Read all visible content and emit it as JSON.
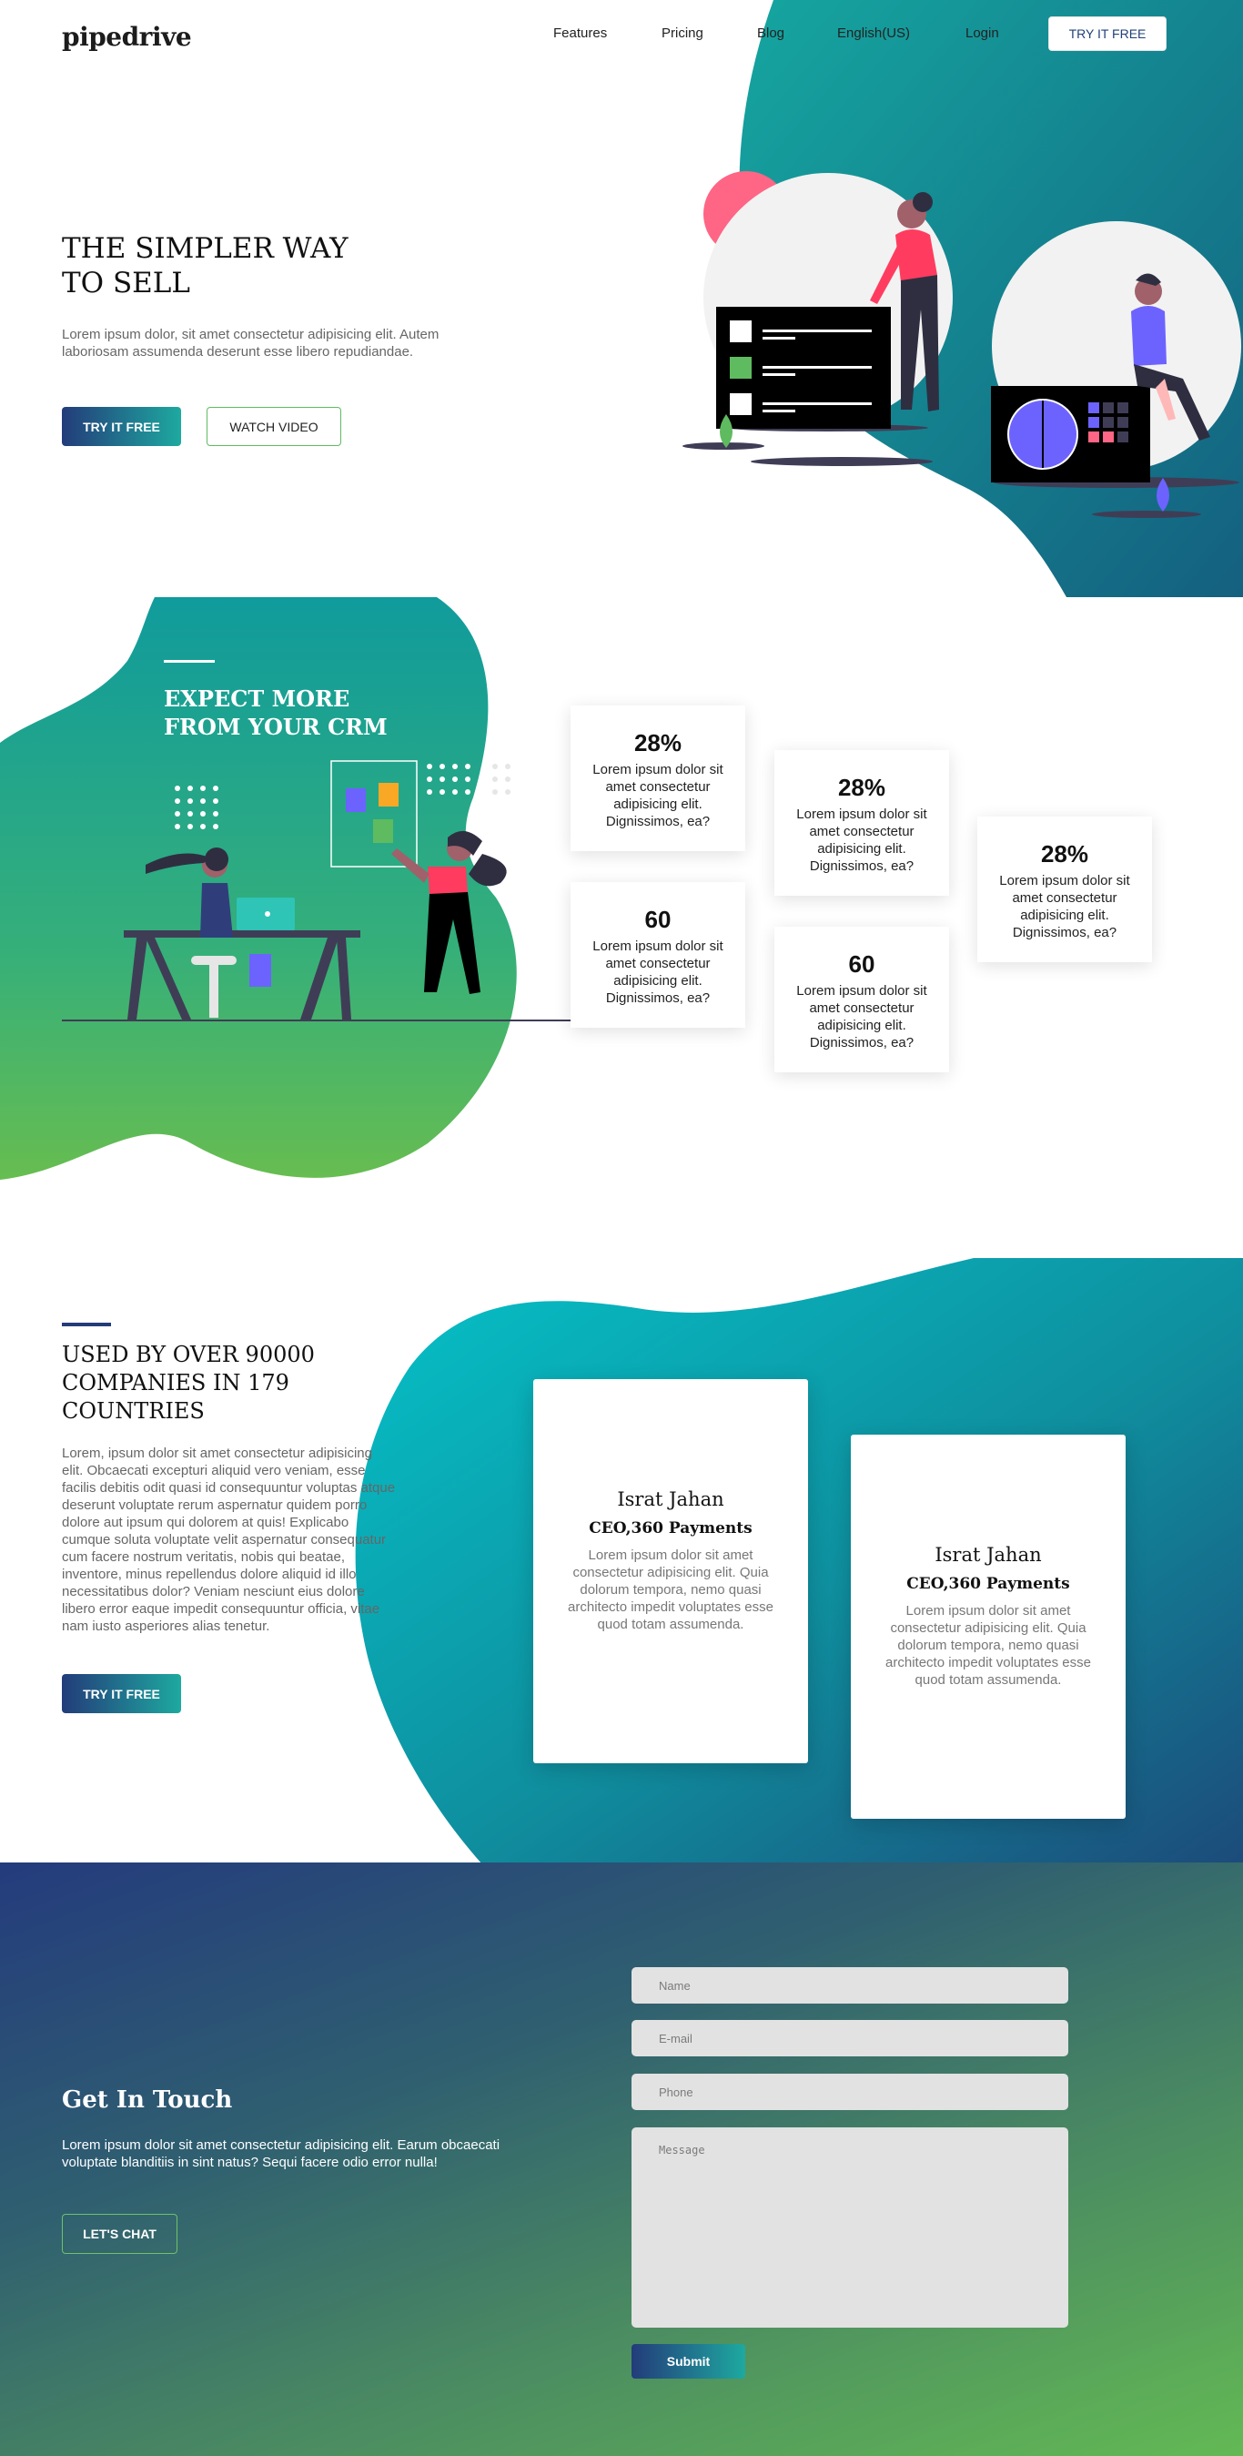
{
  "nav": {
    "logo": "pipedrive",
    "links": [
      "Features",
      "Pricing",
      "Blog",
      "English(US)",
      "Login"
    ],
    "cta": "TRY IT FREE"
  },
  "hero": {
    "title_line1": "THE SIMPLER WAY",
    "title_line2": "TO SELL",
    "text": "Lorem ipsum dolor, sit amet consectetur adipisicing elit. Autem laboriosam assumenda deserunt esse libero repudiandae.",
    "primary_button": "TRY IT FREE",
    "secondary_button": "WATCH VIDEO"
  },
  "crm": {
    "title_line1": "EXPECT MORE",
    "title_line2": "FROM YOUR CRM",
    "stats": [
      {
        "value": "28%",
        "text": "Lorem ipsum dolor sit amet consectetur adipisicing elit. Dignissimos, ea?"
      },
      {
        "value": "28%",
        "text": "Lorem ipsum dolor sit amet consectetur adipisicing elit. Dignissimos, ea?"
      },
      {
        "value": "28%",
        "text": "Lorem ipsum dolor sit amet consectetur adipisicing elit. Dignissimos, ea?"
      },
      {
        "value": "60",
        "text": "Lorem ipsum dolor sit amet consectetur adipisicing elit. Dignissimos, ea?"
      },
      {
        "value": "60",
        "text": "Lorem ipsum dolor sit amet consectetur adipisicing elit. Dignissimos, ea?"
      }
    ]
  },
  "companies": {
    "title_line1": "USED BY OVER 90000",
    "title_line2": "COMPANIES IN 179",
    "title_line3": "COUNTRIES",
    "text": "Lorem, ipsum dolor sit amet consectetur adipisicing elit. Obcaecati excepturi aliquid vero veniam, esse facilis debitis odit quasi id consequuntur voluptas atque deserunt voluptate rerum aspernatur quidem porro dolore aut ipsum qui dolorem at quis! Explicabo cumque soluta voluptate velit aspernatur consequatur cum facere nostrum veritatis, nobis qui beatae, inventore, minus repellendus dolore aliquid id illo necessitatibus dolor? Veniam nesciunt eius dolore libero error eaque impedit consequuntur officia, vitae nam iusto asperiores alias tenetur.",
    "button": "TRY IT FREE",
    "testimonials": [
      {
        "name": "Israt Jahan",
        "role": "CEO,360 Payments",
        "text": "Lorem ipsum dolor sit amet consectetur adipisicing elit. Quia dolorum tempora, nemo quasi architecto impedit voluptates esse quod totam assumenda."
      },
      {
        "name": "Israt Jahan",
        "role": "CEO,360 Payments",
        "text": "Lorem ipsum dolor sit amet consectetur adipisicing elit. Quia dolorum tempora, nemo quasi architecto impedit voluptates esse quod totam assumenda."
      }
    ]
  },
  "contact": {
    "title": "Get In Touch",
    "text": "Lorem ipsum dolor sit amet consectetur adipisicing elit. Earum obcaecati voluptate blanditiis in sint natus? Sequi facere odio error nulla!",
    "chat_button": "LET'S CHAT",
    "name_placeholder": "Name",
    "email_placeholder": "E-mail",
    "phone_placeholder": "Phone",
    "message_placeholder": "Message",
    "submit": "Submit"
  },
  "colors": {
    "teal": "#0e8f96",
    "navy": "#233c7a",
    "green": "#63b954",
    "pink": "#ff5a7a",
    "purple": "#6c63ff"
  },
  "icons": [
    "plant-icon",
    "drop-icon"
  ]
}
